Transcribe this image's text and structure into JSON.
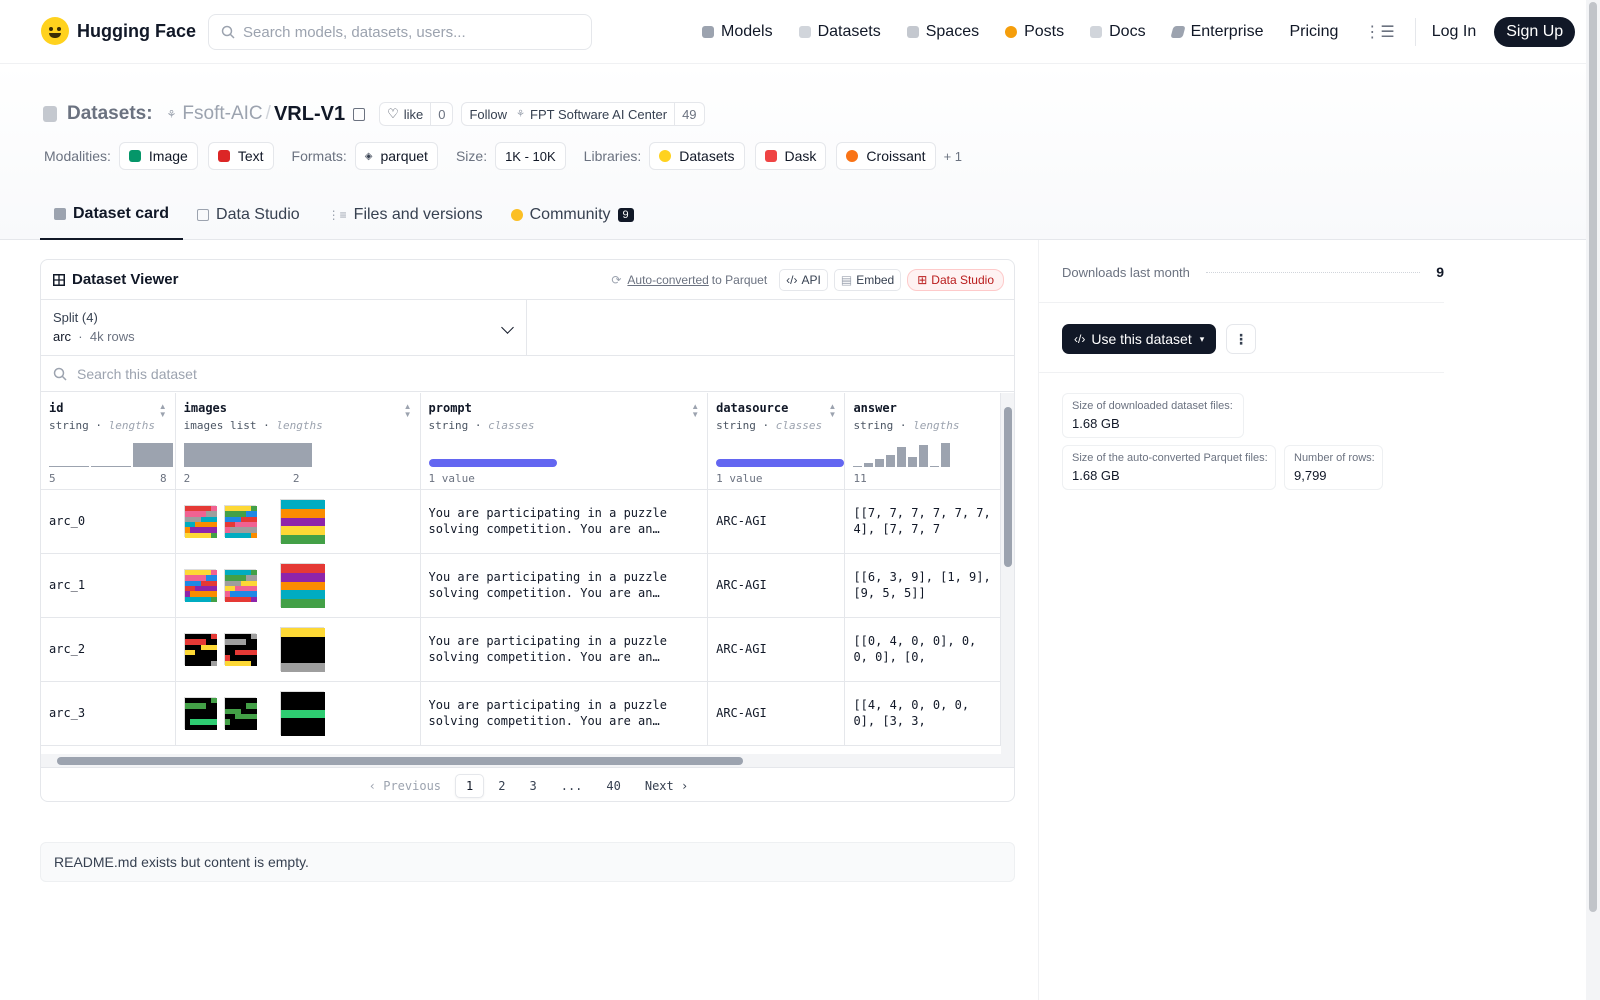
{
  "nav": {
    "brand": "Hugging Face",
    "search_placeholder": "Search models, datasets, users...",
    "links": [
      {
        "label": "Models",
        "color": "#6b7280"
      },
      {
        "label": "Datasets",
        "color": "#9ca3af"
      },
      {
        "label": "Spaces",
        "color": "#6b7280"
      },
      {
        "label": "Posts",
        "color": "#f59e0b"
      },
      {
        "label": "Docs",
        "color": "#9ca3af"
      },
      {
        "label": "Enterprise",
        "color": "#6b7280"
      },
      {
        "label": "Pricing",
        "color": ""
      }
    ],
    "login": "Log In",
    "signup": "Sign Up"
  },
  "header": {
    "section": "Datasets:",
    "owner": "Fsoft-AIC",
    "repo": "VRL-V1",
    "like_label": "like",
    "like_count": "0",
    "follow_label": "Follow",
    "org_name": "FPT Software AI Center",
    "followers": "49",
    "modalities_label": "Modalities:",
    "modalities": [
      {
        "label": "Image",
        "color": "#059669"
      },
      {
        "label": "Text",
        "color": "#dc2626"
      }
    ],
    "formats_label": "Formats:",
    "formats": [
      "parquet"
    ],
    "size_label": "Size:",
    "size": "1K - 10K",
    "libraries_label": "Libraries:",
    "libraries": [
      {
        "label": "Datasets",
        "color": "#ffd21e"
      },
      {
        "label": "Dask",
        "color": "#ef4444"
      },
      {
        "label": "Croissant",
        "color": "#f97316"
      }
    ],
    "libraries_more": "+ 1",
    "tabs": [
      {
        "label": "Dataset card",
        "active": true
      },
      {
        "label": "Data Studio",
        "active": false
      },
      {
        "label": "Files and versions",
        "active": false
      },
      {
        "label": "Community",
        "active": false
      }
    ],
    "community_badge": "9"
  },
  "viewer": {
    "title": "Dataset Viewer",
    "auto_converted": "Auto-converted",
    "to_parquet": "to Parquet",
    "api": "API",
    "embed": "Embed",
    "data_studio": "Data Studio",
    "split_label": "Split (4)",
    "split_name": "arc",
    "split_rows": "4k rows",
    "search_placeholder": "Search this dataset",
    "columns": [
      {
        "name": "id",
        "type": "string",
        "stat": "lengths",
        "min": "5",
        "max": "8"
      },
      {
        "name": "images",
        "type": "images list",
        "stat": "lengths",
        "min": "2",
        "max": "2"
      },
      {
        "name": "prompt",
        "type": "string",
        "stat": "classes",
        "min": "1 value",
        "max": ""
      },
      {
        "name": "datasource",
        "type": "string",
        "stat": "classes",
        "min": "1 value",
        "max": ""
      },
      {
        "name": "answer",
        "type": "string",
        "stat": "lengths",
        "min": "11",
        "max": ""
      }
    ],
    "rows": [
      {
        "id": "arc_0",
        "prompt": "You are participating in a puzzle solving competition. You are an expert at solving puzzles.",
        "datasource": "ARC-AGI",
        "answer": "[[7, 7, 7, 7, 7, 7, 4], [7, 7, 7"
      },
      {
        "id": "arc_1",
        "prompt": "You are participating in a puzzle solving competition. You are an expert at solving puzzles.",
        "datasource": "ARC-AGI",
        "answer": "[[6, 3, 9], [1, 9], [9, 5, 5]]"
      },
      {
        "id": "arc_2",
        "prompt": "You are participating in a puzzle solving competition. You are an expert at solving puzzles.",
        "datasource": "ARC-AGI",
        "answer": "[[0, 4, 0, 0], 0, 0, 0], [0,"
      },
      {
        "id": "arc_3",
        "prompt": "You are participating in a puzzle solving competition. You are an expert at solving puzzles.",
        "datasource": "ARC-AGI",
        "answer": "[[4, 4, 0, 0, 0, 0], [3, 3,"
      }
    ],
    "pager": {
      "prev": "Previous",
      "pages": [
        "1",
        "2",
        "3",
        "...",
        "40"
      ],
      "next": "Next"
    }
  },
  "readme": "README.md exists but content is empty.",
  "sidebar": {
    "downloads_label": "Downloads last month",
    "downloads": "9",
    "use_button": "Use this dataset",
    "downloaded_size_label": "Size of downloaded dataset files:",
    "downloaded_size": "1.68 GB",
    "parquet_size_label": "Size of the auto-converted Parquet files:",
    "parquet_size": "1.68 GB",
    "rows_label": "Number of rows:",
    "rows": "9,799"
  }
}
